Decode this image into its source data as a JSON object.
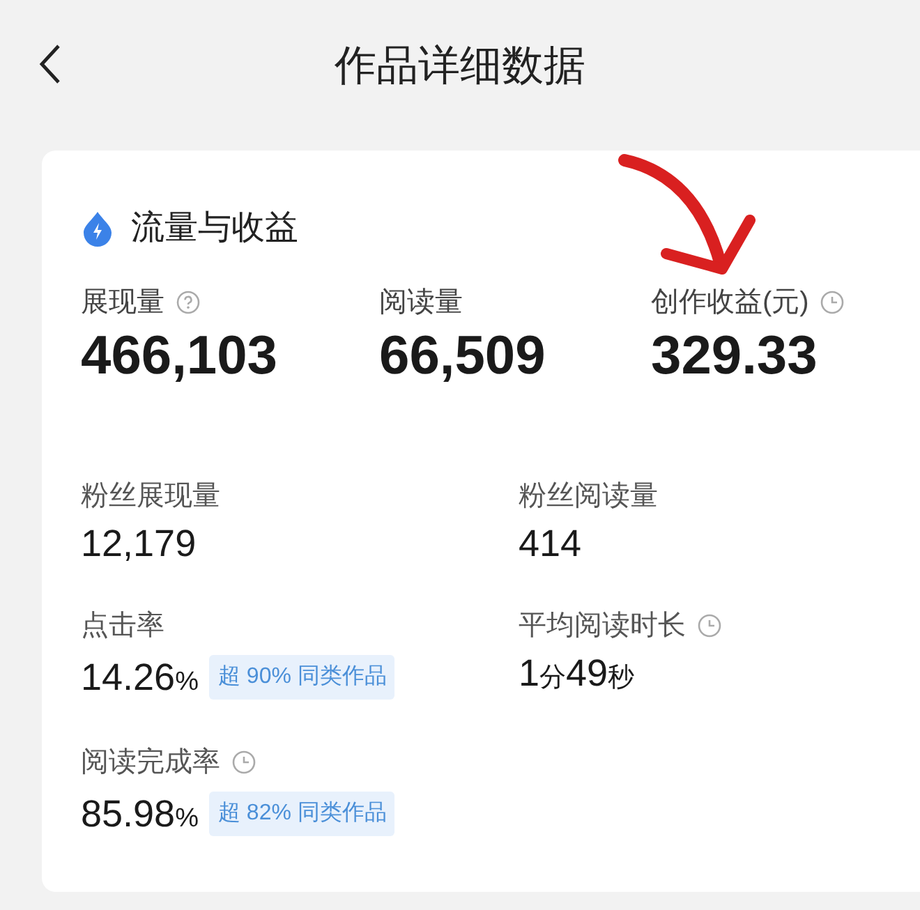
{
  "header": {
    "title": "作品详细数据"
  },
  "section": {
    "title": "流量与收益"
  },
  "top_metrics": [
    {
      "label": "展现量",
      "hint_icon": {
        "kind": "info"
      },
      "value": "466,103"
    },
    {
      "label": "阅读量",
      "value": "66,509"
    },
    {
      "label": "创作收益(元)",
      "hint_icon": {
        "kind": "clock"
      },
      "value": "329.33"
    }
  ],
  "metrics": [
    {
      "label": "粉丝展现量",
      "value_parts": [
        {
          "kind": "number",
          "text": "12,179"
        }
      ]
    },
    {
      "label": "粉丝阅读量",
      "value_parts": [
        {
          "kind": "number",
          "text": "414"
        }
      ]
    },
    {
      "label": "点击率",
      "value_parts": [
        {
          "kind": "number",
          "text": "14.26"
        },
        {
          "kind": "unit",
          "text": "%"
        }
      ],
      "badge": "超 90% 同类作品"
    },
    {
      "label": "平均阅读时长",
      "hint_icon": {
        "kind": "clock"
      },
      "value_parts": [
        {
          "kind": "number",
          "text": "1"
        },
        {
          "kind": "unit",
          "text": "分"
        },
        {
          "kind": "number",
          "text": "49"
        },
        {
          "kind": "unit",
          "text": "秒"
        }
      ]
    },
    {
      "label": "阅读完成率",
      "hint_icon": {
        "kind": "clock"
      },
      "value_parts": [
        {
          "kind": "number",
          "text": "85.98"
        },
        {
          "kind": "unit",
          "text": "%"
        }
      ],
      "badge": "超 82% 同类作品"
    }
  ],
  "annotation": {
    "kind": "arrow"
  }
}
